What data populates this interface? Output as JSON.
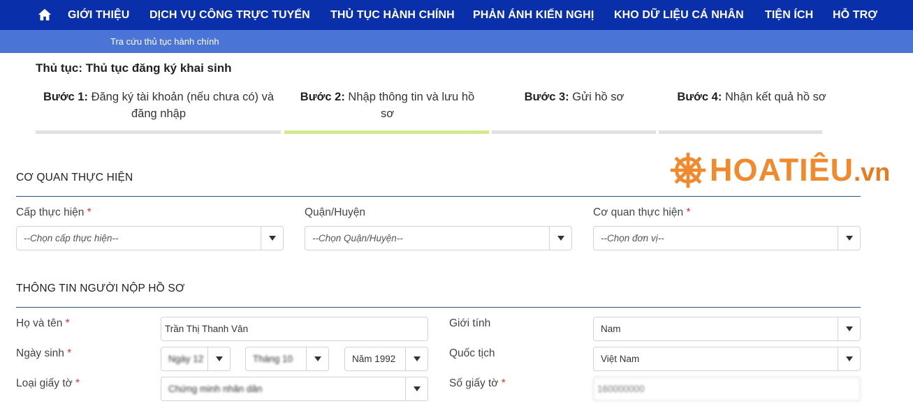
{
  "nav": {
    "home_icon": "home-icon",
    "items": [
      "GIỚI THIỆU",
      "DỊCH VỤ CÔNG TRỰC TUYẾN",
      "THỦ TỤC HÀNH CHÍNH",
      "PHẢN ÁNH KIẾN NGHỊ",
      "KHO DỮ LIỆU CÁ NHÂN",
      "TIỆN ÍCH",
      "HỖ TRỢ"
    ],
    "bg_color": "#0a2faa"
  },
  "subnav": {
    "item": "Tra cứu thủ tục hành chính",
    "bg_color": "#4a74d6"
  },
  "procedure": {
    "title": "Thủ tục: Thủ tục đăng ký khai sinh"
  },
  "steps": [
    {
      "num": "Bước 1:",
      "text": "Đăng ký tài khoản (nếu chưa có) và",
      "text2": "đăng nhập",
      "active": false
    },
    {
      "num": "Bước 2:",
      "text": "Nhập thông tin và lưu hồ",
      "text2": "sơ",
      "active": true
    },
    {
      "num": "Bước 3:",
      "text": "Gửi hồ sơ",
      "text2": "",
      "active": false
    },
    {
      "num": "Bước 4:",
      "text": "Nhận kết quả hồ sơ",
      "text2": "",
      "active": false
    }
  ],
  "logo": {
    "text": "HOATIÊU",
    "suffix": ".vn",
    "color": "#f08a2c"
  },
  "agency_section": {
    "title": "CƠ QUAN THỰC HIỆN",
    "level_label": "Cấp thực hiện",
    "level_placeholder": "--Chọn cấp thực hiện--",
    "district_label": "Quận/Huyện",
    "district_placeholder": "--Chọn Quận/Huyện--",
    "agency_label": "Cơ quan thực hiện",
    "agency_placeholder": "--Chọn đơn vị--",
    "required_mark": "*"
  },
  "applicant_section": {
    "title": "THÔNG TIN NGƯỜI NỘP HỒ SƠ",
    "name_label": "Họ và tên",
    "name_value": "Trần Thị Thanh Vân",
    "gender_label": "Giới tính",
    "gender_value": "Nam",
    "dob_label": "Ngày sinh",
    "dob_day": "Ngày 12",
    "dob_month": "Tháng 10",
    "dob_year": "Năm 1992",
    "nationality_label": "Quốc tịch",
    "nationality_value": "Việt Nam",
    "doctype_label": "Loại giấy tờ",
    "doctype_value": "Chứng minh nhân dân",
    "docnum_label": "Số giấy tờ",
    "docnum_value": "160000000"
  }
}
